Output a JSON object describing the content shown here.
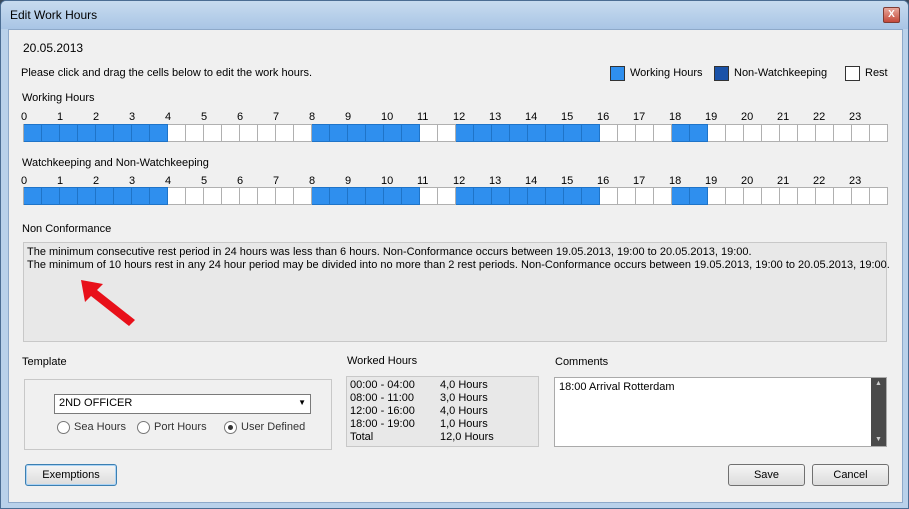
{
  "window": {
    "title": "Edit Work Hours",
    "close_label": "X"
  },
  "date": "20.05.2013",
  "instruction": "Please click and drag the cells below to edit the work hours.",
  "legend": [
    {
      "label": "Working Hours",
      "color": "#2f8fee"
    },
    {
      "label": "Non-Watchkeeping",
      "color": "#1a52a8"
    },
    {
      "label": "Rest",
      "color": "#ffffff"
    }
  ],
  "hour_labels": [
    "0",
    "1",
    "2",
    "3",
    "4",
    "5",
    "6",
    "7",
    "8",
    "9",
    "10",
    "11",
    "12",
    "13",
    "14",
    "15",
    "16",
    "17",
    "18",
    "19",
    "20",
    "21",
    "22",
    "23"
  ],
  "working_hours": {
    "label": "Working Hours",
    "cells": [
      1,
      1,
      1,
      1,
      1,
      1,
      1,
      1,
      0,
      0,
      0,
      0,
      0,
      0,
      0,
      0,
      1,
      1,
      1,
      1,
      1,
      1,
      0,
      0,
      1,
      1,
      1,
      1,
      1,
      1,
      1,
      1,
      0,
      0,
      0,
      0,
      1,
      1,
      0,
      0,
      0,
      0,
      0,
      0,
      0,
      0,
      0,
      0
    ]
  },
  "watchkeeping": {
    "label": "Watchkeeping and Non-Watchkeeping",
    "cells": [
      1,
      1,
      1,
      1,
      1,
      1,
      1,
      1,
      0,
      0,
      0,
      0,
      0,
      0,
      0,
      0,
      1,
      1,
      1,
      1,
      1,
      1,
      0,
      0,
      1,
      1,
      1,
      1,
      1,
      1,
      1,
      1,
      0,
      0,
      0,
      0,
      1,
      1,
      0,
      0,
      0,
      0,
      0,
      0,
      0,
      0,
      0,
      0
    ]
  },
  "non_conformance": {
    "label": "Non Conformance",
    "lines": [
      "The minimum consecutive rest period in 24 hours was less than 6 hours. Non-Conformance occurs between 19.05.2013, 19:00 to 20.05.2013, 19:00.",
      "The minimum of 10 hours rest in any 24 hour period may be divided into no more than 2 rest periods. Non-Conformance occurs between 19.05.2013, 19:00 to 20.05.2013, 19:00."
    ]
  },
  "template": {
    "label": "Template",
    "selected": "2ND OFFICER",
    "radios": [
      {
        "label": "Sea Hours",
        "checked": false
      },
      {
        "label": "Port Hours",
        "checked": false
      },
      {
        "label": "User Defined",
        "checked": true
      }
    ]
  },
  "worked_hours": {
    "label": "Worked Hours",
    "rows": [
      {
        "range": "00:00 - 04:00",
        "value": "4,0 Hours"
      },
      {
        "range": "08:00 - 11:00",
        "value": "3,0 Hours"
      },
      {
        "range": "12:00 - 16:00",
        "value": "4,0 Hours"
      },
      {
        "range": "18:00 - 19:00",
        "value": "1,0 Hours"
      },
      {
        "range": "Total",
        "value": "12,0 Hours"
      }
    ]
  },
  "comments": {
    "label": "Comments",
    "text": "18:00 Arrival Rotterdam"
  },
  "buttons": {
    "exemptions": "Exemptions",
    "save": "Save",
    "cancel": "Cancel"
  }
}
